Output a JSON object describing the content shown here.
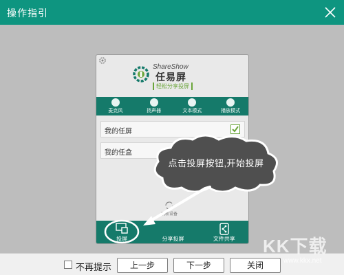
{
  "window": {
    "title": "操作指引",
    "close_icon": "close-icon"
  },
  "app": {
    "settings_icon": "gear-icon",
    "logo": {
      "brand_en": "ShareShow",
      "brand_cn": "任易屏",
      "slogan": "轻松分享投屏"
    },
    "modes": [
      {
        "label": "麦克风",
        "icon": "microphone-icon"
      },
      {
        "label": "扬声器",
        "icon": "speaker-icon"
      },
      {
        "label": "文本模式",
        "icon": "text-icon"
      },
      {
        "label": "播放模式",
        "icon": "play-icon"
      }
    ],
    "devices": [
      {
        "label": "我的任屏",
        "checked": true
      },
      {
        "label": "我的任盒",
        "checked": false
      }
    ],
    "refresh_label": "刷新设备",
    "tabs": [
      {
        "label": "投屏",
        "icon": "cast-icon"
      },
      {
        "label": "分享投屏",
        "icon": "screen-share-icon"
      },
      {
        "label": "文件共享",
        "icon": "share-icon"
      }
    ]
  },
  "guide": {
    "bubble_text": "点击投屏按钮,开始投屏"
  },
  "footer": {
    "no_more_tip_label": "不再提示",
    "no_more_tip_checked": false,
    "prev_label": "上一步",
    "next_label": "下一步",
    "close_label": "关闭"
  },
  "watermark": {
    "big": "KK下载",
    "small": "www.kkx.net"
  },
  "colors": {
    "title_bar": "#0e9580",
    "app_bar": "#157a6a",
    "check_green": "#6aa53a"
  }
}
